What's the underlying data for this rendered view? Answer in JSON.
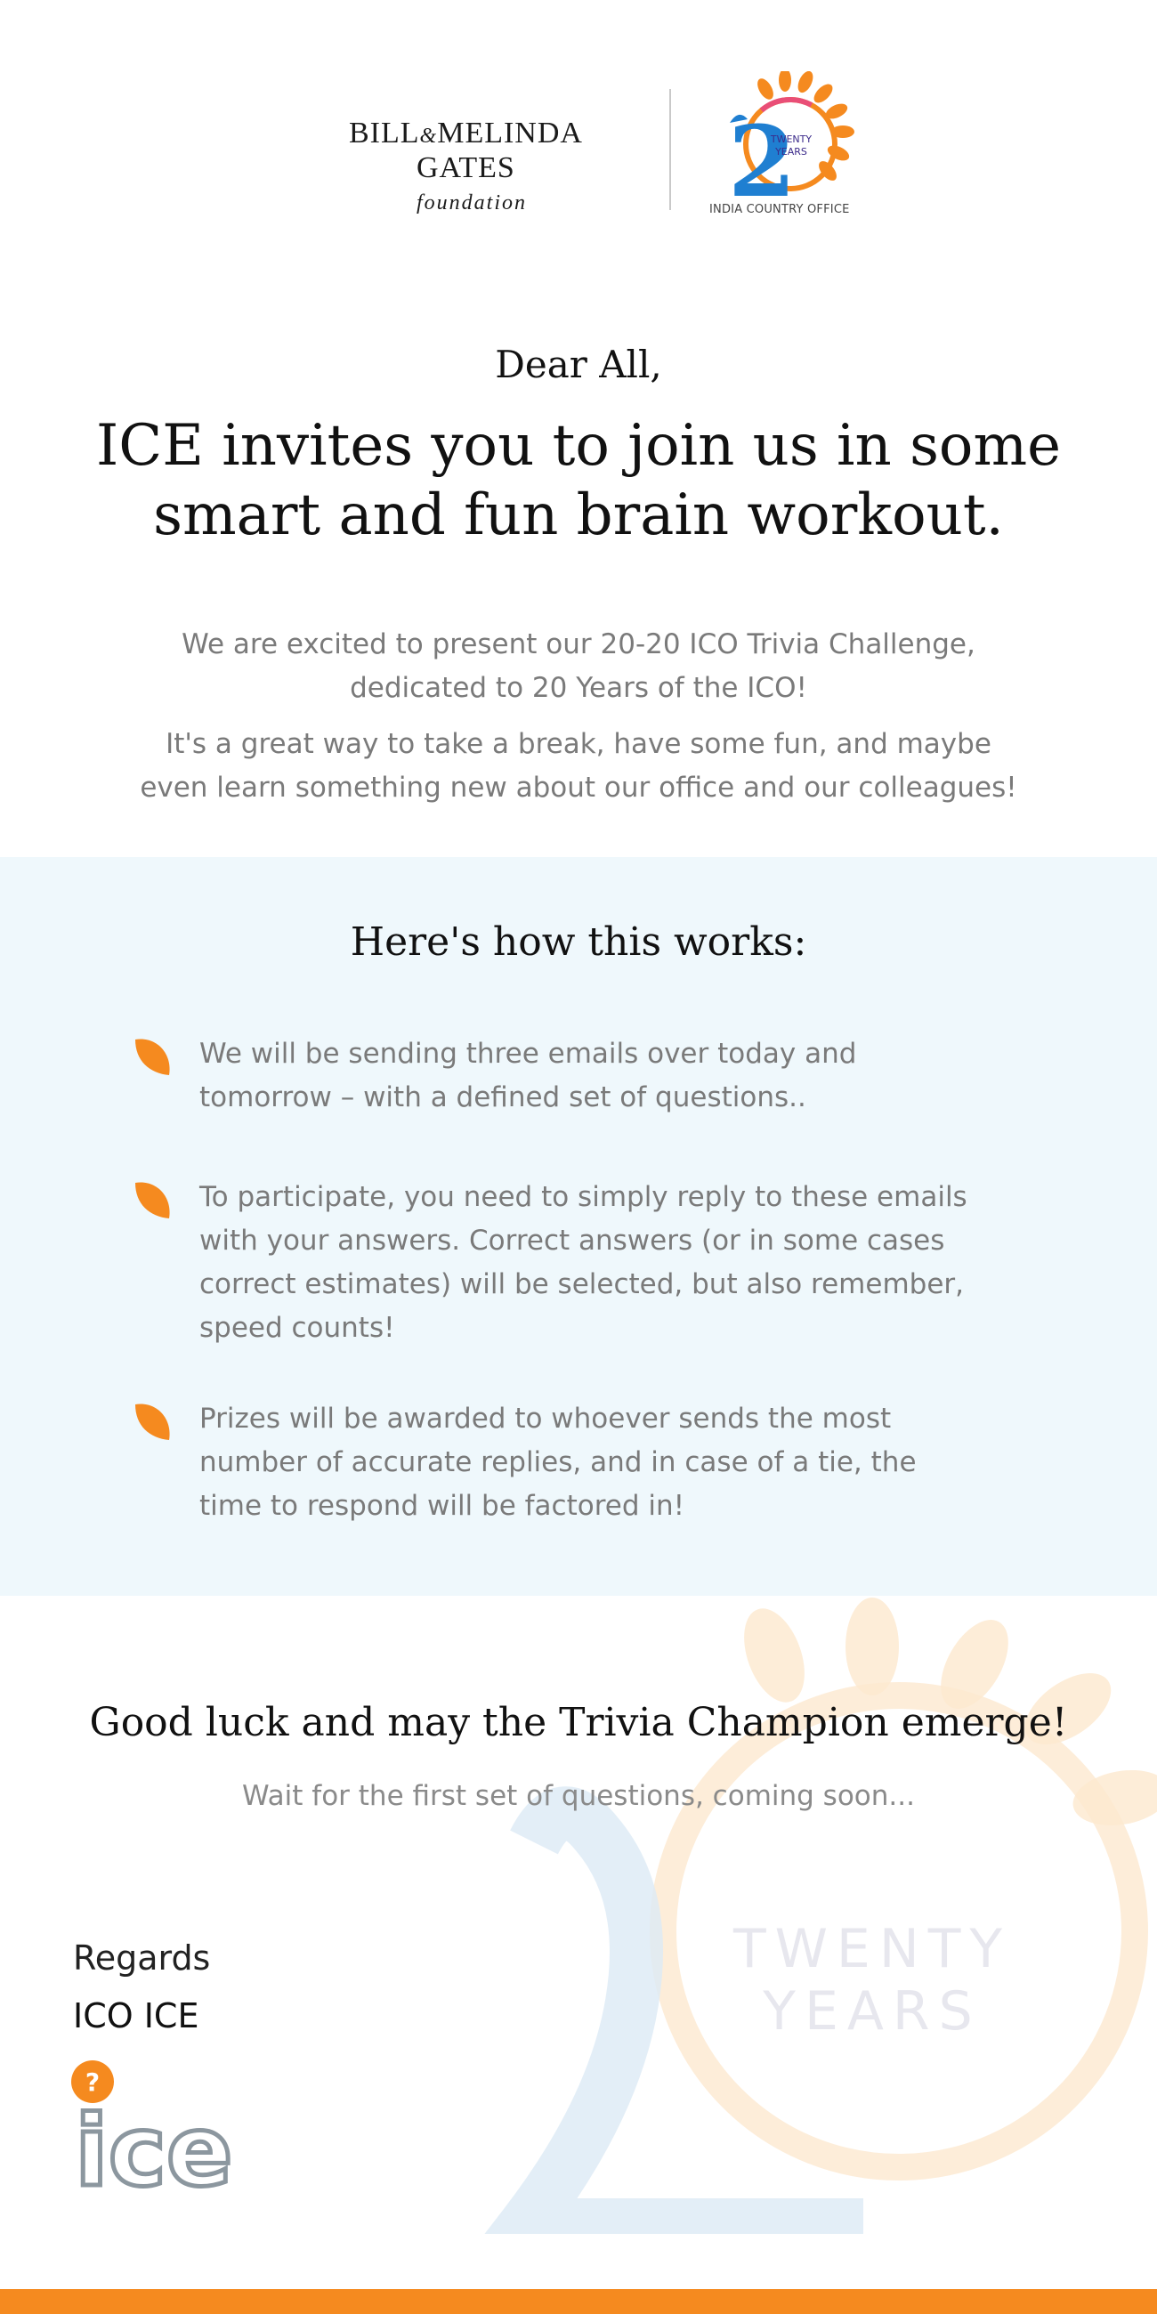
{
  "header": {
    "gates_line1": "BILL",
    "gates_amp": "&",
    "gates_line1b": "MELINDA",
    "gates_line2": "GATES",
    "gates_foundation": "foundation",
    "anniversary_badge": "TWENTY YEARS",
    "anniversary_badge_line1": "TWENTY",
    "anniversary_badge_line2": "YEARS",
    "anniversary_numeral": "2",
    "office_label": "INDIA COUNTRY OFFICE"
  },
  "greeting": "Dear All,",
  "headline": "ICE invites you to join us in some smart and fun brain workout.",
  "intro": {
    "paragraph1": "We are excited to present our 20-20 ICO Trivia Challenge, dedicated to 20 Years of the ICO!",
    "paragraph2": "It's a great way to take a break, have some fun, and maybe even learn something new about our office and our colleagues!"
  },
  "how_it_works": {
    "title": "Here's how this works:",
    "steps": [
      "We will be sending three emails over today and tomorrow – with a defined set of questions..",
      "To participate, you need to simply reply to these emails with your answers.  Correct answers (or in some cases correct estimates) will be selected, but also remember, speed counts!",
      "Prizes will be awarded to whoever sends the most number of accurate replies, and in case of a tie, the time to respond will be factored in!"
    ]
  },
  "closing": {
    "good_luck": "Good luck and may the Trivia Champion emerge!",
    "wait": "Wait for the first set of questions, coming soon...",
    "watermark_line1": "TWENTY",
    "watermark_line2": "YEARS",
    "regards": "Regards",
    "signature": "ICO ICE",
    "ice_logo_text": "ice",
    "ice_logo_badge": "?"
  },
  "colors": {
    "accent_orange": "#f58a1f",
    "section_bg": "#eff8fc",
    "body_text": "#7a7a7a",
    "logo_blue": "#1f7fd1"
  }
}
